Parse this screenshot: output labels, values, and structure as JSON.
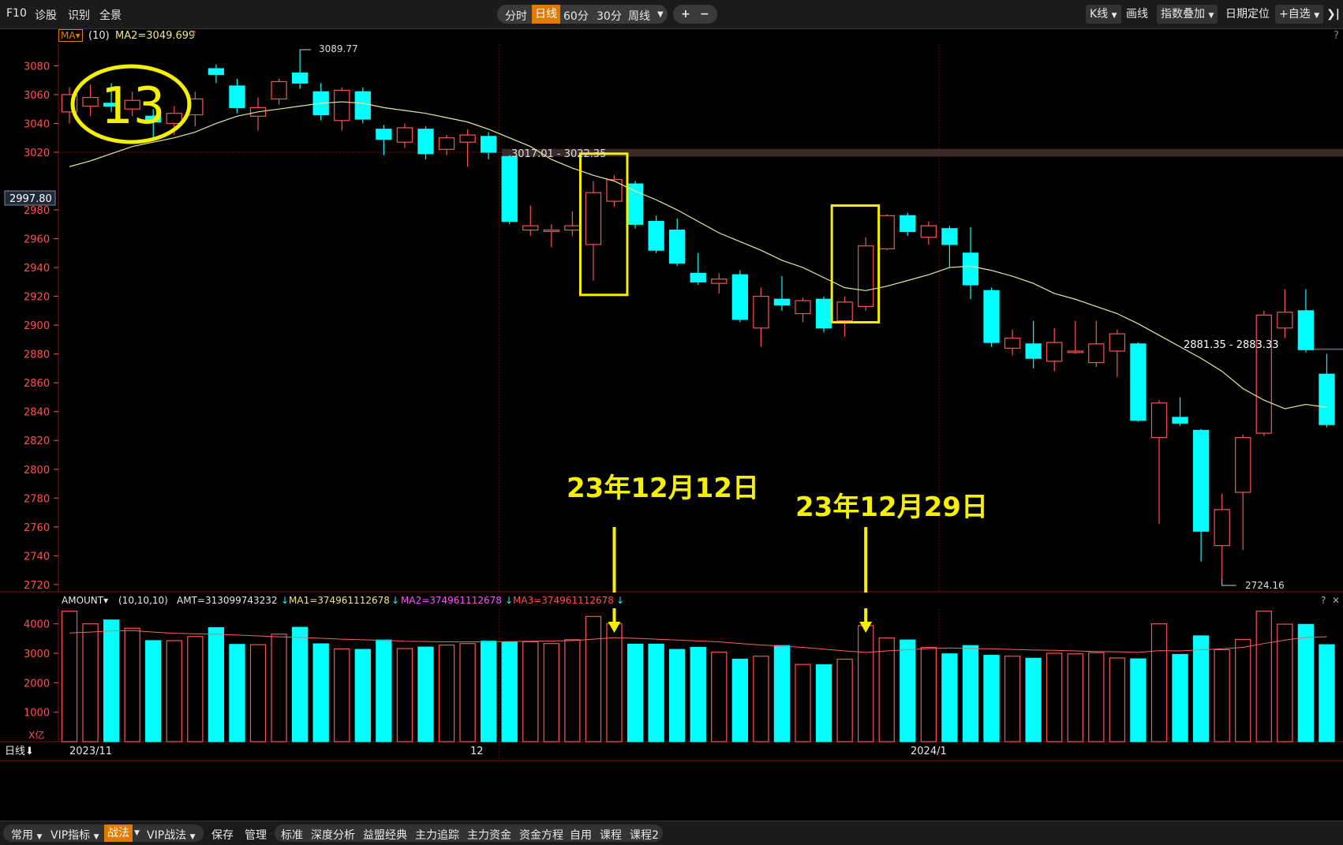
{
  "toolbar": {
    "left": [
      "F10",
      "诊股",
      "识别",
      "全景"
    ],
    "periods": [
      "分时",
      "日线",
      "60分",
      "30分",
      "周线"
    ],
    "active_period": "日线",
    "zoom_in": "+",
    "zoom_out": "−",
    "right": [
      "K线",
      "画线",
      "指数叠加",
      "日期定位",
      "+自选"
    ],
    "expand": "❯|"
  },
  "ma_bar": {
    "selector": "MA",
    "params": "(10)",
    "ma2": "MA2=3049.699",
    "help": "?"
  },
  "current_price_tag": "2997.80",
  "price_axis": [
    "3080",
    "3060",
    "3040",
    "3020",
    "2980",
    "2960",
    "2940",
    "2920",
    "2900",
    "2880",
    "2860",
    "2840",
    "2820",
    "2800",
    "2780",
    "2760",
    "2740",
    "2720"
  ],
  "annotations": {
    "circle_number": "13",
    "high_label": "3089.77",
    "low_label": "2724.16",
    "range1": "3017.01 - 3022.35",
    "range2": "2881.35 - 2883.33",
    "date1": "23年12月12日",
    "date2": "23年12月29日"
  },
  "volume_bar": {
    "name": "AMOUNT",
    "params": "(10,10,10)",
    "amt": "AMT=313099743232",
    "ma1": "MA1=374961112678",
    "ma2": "MA2=374961112678",
    "ma3": "MA3=374961112678",
    "help": "?",
    "close": "✕",
    "unit": "X亿"
  },
  "volume_axis": [
    "4000",
    "3000",
    "2000",
    "1000"
  ],
  "date_axis": {
    "period_label": "日线",
    "labels": [
      "2023/11",
      "12",
      "2024/1"
    ]
  },
  "bottom_bar": {
    "items": [
      "常用",
      "VIP指标",
      "战法",
      "VIP战法",
      "保存",
      "管理"
    ],
    "tabs": [
      "标准",
      "深度分析",
      "益盟经典",
      "主力追踪",
      "主力资金",
      "资金方程",
      "自用",
      "课程",
      "课程2"
    ]
  },
  "colors": {
    "up": "#ff5050",
    "down": "#00ffff",
    "ma": "#e8e89a",
    "annotation": "#f5f000",
    "axis_text": "#ff5050"
  },
  "chart_data": {
    "type": "candlestick",
    "y_range": [
      2715,
      3095
    ],
    "candles": [
      {
        "o": 3048,
        "c": 3060,
        "h": 3065,
        "l": 3040
      },
      {
        "o": 3052,
        "c": 3058,
        "h": 3067,
        "l": 3045
      },
      {
        "o": 3054,
        "c": 3052,
        "h": 3068,
        "l": 3048
      },
      {
        "o": 3050,
        "c": 3056,
        "h": 3062,
        "l": 3045
      },
      {
        "o": 3045,
        "c": 3041,
        "h": 3050,
        "l": 3030
      },
      {
        "o": 3040,
        "c": 3047,
        "h": 3052,
        "l": 3032
      },
      {
        "o": 3046,
        "c": 3057,
        "h": 3062,
        "l": 3038
      },
      {
        "o": 3078,
        "c": 3074,
        "h": 3081,
        "l": 3068
      },
      {
        "o": 3066,
        "c": 3051,
        "h": 3071,
        "l": 3047
      },
      {
        "o": 3045,
        "c": 3051,
        "h": 3058,
        "l": 3035
      },
      {
        "o": 3057,
        "c": 3069,
        "h": 3071,
        "l": 3053
      },
      {
        "o": 3075,
        "c": 3068,
        "h": 3089.77,
        "l": 3064
      },
      {
        "o": 3062,
        "c": 3046,
        "h": 3068,
        "l": 3042
      },
      {
        "o": 3042,
        "c": 3063,
        "h": 3065,
        "l": 3035
      },
      {
        "o": 3062,
        "c": 3043,
        "h": 3065,
        "l": 3040
      },
      {
        "o": 3036,
        "c": 3029,
        "h": 3039,
        "l": 3018
      },
      {
        "o": 3027,
        "c": 3037,
        "h": 3040,
        "l": 3023
      },
      {
        "o": 3036,
        "c": 3019,
        "h": 3038,
        "l": 3015
      },
      {
        "o": 3022,
        "c": 3030,
        "h": 3032,
        "l": 3018
      },
      {
        "o": 3027,
        "c": 3032,
        "h": 3036,
        "l": 3010
      },
      {
        "o": 3031,
        "c": 3020,
        "h": 3034,
        "l": 3015
      },
      {
        "o": 3017,
        "c": 2972,
        "h": 3018,
        "l": 2970
      },
      {
        "o": 2966,
        "c": 2969,
        "h": 2983,
        "l": 2962
      },
      {
        "o": 2965,
        "c": 2966,
        "h": 2970,
        "l": 2954
      },
      {
        "o": 2966,
        "c": 2969,
        "h": 2979,
        "l": 2962
      },
      {
        "o": 2956,
        "c": 2992,
        "h": 3000,
        "l": 2931
      },
      {
        "o": 2986,
        "c": 3001,
        "h": 3004,
        "l": 2982
      },
      {
        "o": 2998,
        "c": 2970,
        "h": 3000,
        "l": 2967
      },
      {
        "o": 2972,
        "c": 2952,
        "h": 2976,
        "l": 2950
      },
      {
        "o": 2966,
        "c": 2943,
        "h": 2974,
        "l": 2941
      },
      {
        "o": 2936,
        "c": 2930,
        "h": 2950,
        "l": 2928
      },
      {
        "o": 2929,
        "c": 2932,
        "h": 2936,
        "l": 2922
      },
      {
        "o": 2935,
        "c": 2904,
        "h": 2938,
        "l": 2902
      },
      {
        "o": 2898,
        "c": 2920,
        "h": 2926,
        "l": 2885
      },
      {
        "o": 2918,
        "c": 2914,
        "h": 2934,
        "l": 2910
      },
      {
        "o": 2908,
        "c": 2917,
        "h": 2919,
        "l": 2902
      },
      {
        "o": 2918,
        "c": 2898,
        "h": 2920,
        "l": 2895
      },
      {
        "o": 2903,
        "c": 2916,
        "h": 2920,
        "l": 2892
      },
      {
        "o": 2913,
        "c": 2955,
        "h": 2961,
        "l": 2910
      },
      {
        "o": 2953,
        "c": 2976,
        "h": 2977,
        "l": 2952
      },
      {
        "o": 2976,
        "c": 2965,
        "h": 2978,
        "l": 2962
      },
      {
        "o": 2961,
        "c": 2969,
        "h": 2972,
        "l": 2956
      },
      {
        "o": 2967,
        "c": 2956,
        "h": 2969,
        "l": 2940
      },
      {
        "o": 2950,
        "c": 2928,
        "h": 2968,
        "l": 2918
      },
      {
        "o": 2924,
        "c": 2888,
        "h": 2926,
        "l": 2885
      },
      {
        "o": 2884,
        "c": 2891,
        "h": 2897,
        "l": 2879
      },
      {
        "o": 2887,
        "c": 2877,
        "h": 2903,
        "l": 2870
      },
      {
        "o": 2875,
        "c": 2888,
        "h": 2898,
        "l": 2868
      },
      {
        "o": 2881,
        "c": 2882,
        "h": 2903,
        "l": 2880
      },
      {
        "o": 2874,
        "c": 2887,
        "h": 2903,
        "l": 2871
      },
      {
        "o": 2882,
        "c": 2894,
        "h": 2897,
        "l": 2864
      },
      {
        "o": 2887,
        "c": 2834,
        "h": 2888,
        "l": 2833
      },
      {
        "o": 2822,
        "c": 2846,
        "h": 2848,
        "l": 2762
      },
      {
        "o": 2836,
        "c": 2832,
        "h": 2850,
        "l": 2830
      },
      {
        "o": 2827,
        "c": 2757,
        "h": 2828,
        "l": 2736
      },
      {
        "o": 2747,
        "c": 2772,
        "h": 2783,
        "l": 2724.16
      },
      {
        "o": 2784,
        "c": 2822,
        "h": 2824,
        "l": 2744
      },
      {
        "o": 2825,
        "c": 2907,
        "h": 2910,
        "l": 2823
      },
      {
        "o": 2898,
        "c": 2909,
        "h": 2925,
        "l": 2891
      },
      {
        "o": 2910,
        "c": 2883,
        "h": 2925,
        "l": 2881
      },
      {
        "o": 2866,
        "c": 2831,
        "h": 2880,
        "l": 2829
      }
    ],
    "ma": [
      3010,
      3014,
      3019,
      3024,
      3027,
      3030,
      3034,
      3040,
      3045,
      3048,
      3050,
      3052,
      3054,
      3055,
      3054,
      3051,
      3049,
      3047,
      3044,
      3041,
      3036,
      3030,
      3024,
      3015,
      3009,
      3004,
      3000,
      2993,
      2987,
      2980,
      2972,
      2964,
      2958,
      2952,
      2945,
      2940,
      2933,
      2926,
      2924,
      2927,
      2931,
      2935,
      2940,
      2941,
      2938,
      2934,
      2929,
      2922,
      2918,
      2913,
      2908,
      2901,
      2893,
      2885,
      2877,
      2868,
      2856,
      2848,
      2842,
      2845,
      2843
    ],
    "volume": [
      4430,
      4000,
      4130,
      3850,
      3430,
      3430,
      3570,
      3870,
      3300,
      3290,
      3650,
      3880,
      3320,
      3150,
      3130,
      3450,
      3160,
      3210,
      3280,
      3330,
      3410,
      3380,
      3390,
      3330,
      3460,
      4250,
      4000,
      3310,
      3310,
      3130,
      3200,
      3040,
      2800,
      2900,
      3260,
      2620,
      2610,
      2800,
      3940,
      3520,
      3450,
      3200,
      2980,
      3260,
      2930,
      2900,
      2830,
      3000,
      2980,
      3020,
      2840,
      2810,
      4000,
      2960,
      3590,
      3120,
      3470,
      4430,
      3990,
      3980,
      3290
    ],
    "volume_ma": [
      3690,
      3720,
      3760,
      3770,
      3720,
      3680,
      3660,
      3650,
      3620,
      3590,
      3560,
      3540,
      3510,
      3480,
      3460,
      3440,
      3410,
      3400,
      3390,
      3390,
      3390,
      3400,
      3410,
      3420,
      3430,
      3480,
      3530,
      3510,
      3480,
      3450,
      3420,
      3390,
      3330,
      3280,
      3240,
      3200,
      3140,
      3080,
      3030,
      3080,
      3120,
      3160,
      3180,
      3160,
      3150,
      3130,
      3110,
      3100,
      3080,
      3060,
      3050,
      3030,
      3090,
      3080,
      3120,
      3150,
      3200,
      3330,
      3450,
      3540,
      3560
    ],
    "volume_range": [
      0,
      4500
    ]
  }
}
